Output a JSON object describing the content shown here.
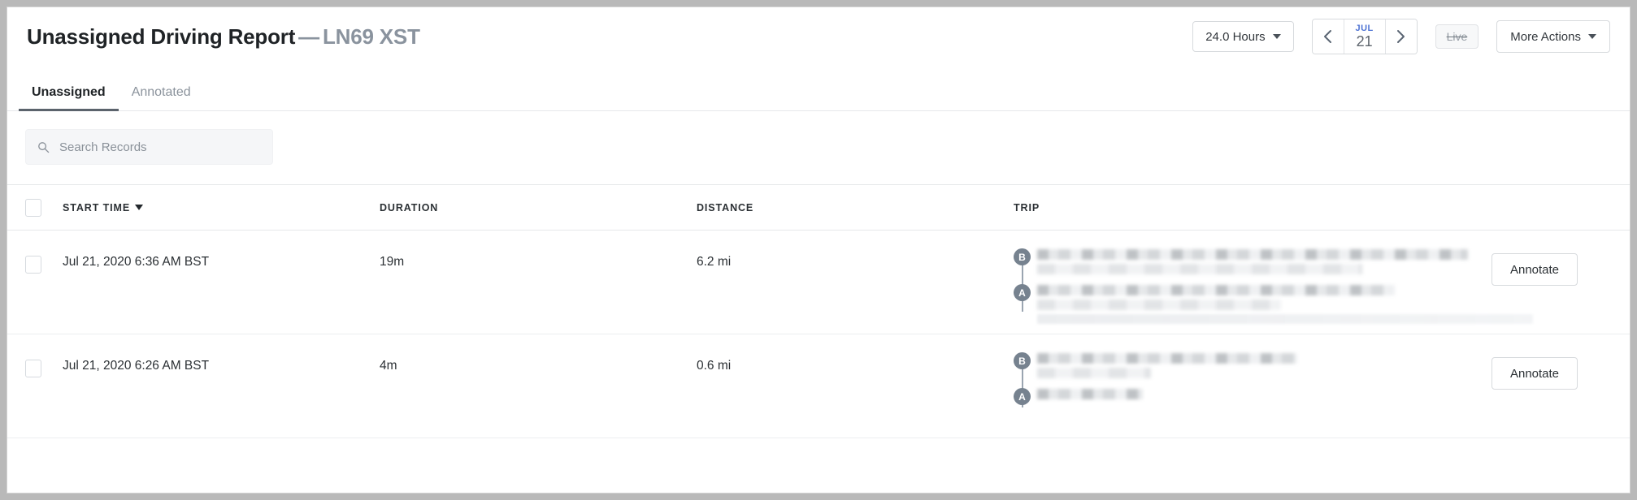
{
  "header": {
    "title_main": "Unassigned Driving Report",
    "dash": "—",
    "vehicle": "LN69 XST",
    "duration_filter": "24.0 Hours",
    "date": {
      "month": "JUL",
      "day": "21"
    },
    "prev_label": "Previous day",
    "next_label": "Next day",
    "live_label": "Live",
    "more_actions_label": "More Actions"
  },
  "tabs": [
    {
      "label": "Unassigned",
      "active": true
    },
    {
      "label": "Annotated",
      "active": false
    }
  ],
  "search": {
    "placeholder": "Search Records",
    "value": "",
    "icon": "search-icon"
  },
  "table": {
    "columns": [
      {
        "key": "start_time",
        "label": "START TIME",
        "sorted": true,
        "sort_dir": "desc"
      },
      {
        "key": "duration",
        "label": "DURATION"
      },
      {
        "key": "distance",
        "label": "DISTANCE"
      },
      {
        "key": "trip",
        "label": "TRIP"
      }
    ],
    "rows": [
      {
        "start_time": "Jul 21, 2020 6:36 AM BST",
        "duration": "19m",
        "distance": "6.2 mi",
        "trip": {
          "end_marker": "B",
          "start_marker": "A",
          "end_address_redacted": true,
          "start_address_redacted": true
        },
        "action_label": "Annotate"
      },
      {
        "start_time": "Jul 21, 2020 6:26 AM BST",
        "duration": "4m",
        "distance": "0.6 mi",
        "trip": {
          "end_marker": "B",
          "start_marker": "A",
          "end_address_redacted": true,
          "start_address_redacted": true
        },
        "action_label": "Annotate"
      }
    ]
  },
  "colors": {
    "accent_blue": "#4f74d4",
    "marker_gray": "#76828f",
    "text_dark": "#1f2326",
    "text_muted": "#8a939e",
    "tab_underline": "#5b636c",
    "border": "#e6e8ea"
  }
}
